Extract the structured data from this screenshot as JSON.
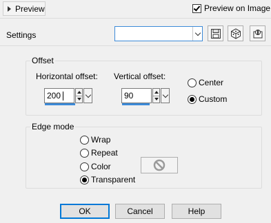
{
  "topbar": {
    "preview_label": "Preview",
    "preview_on_image_label": "Preview on Image",
    "preview_on_image_checked": true
  },
  "settings": {
    "label": "Settings",
    "preset_value": ""
  },
  "offset": {
    "title": "Offset",
    "horizontal_label": "Horizontal offset:",
    "horizontal_value": "200",
    "vertical_label": "Vertical offset:",
    "vertical_value": "90",
    "modes": [
      {
        "label": "Center",
        "selected": false
      },
      {
        "label": "Custom",
        "selected": true
      }
    ]
  },
  "edge_mode": {
    "title": "Edge mode",
    "options": [
      {
        "label": "Wrap",
        "selected": false
      },
      {
        "label": "Repeat",
        "selected": false
      },
      {
        "label": "Color",
        "selected": false
      },
      {
        "label": "Transparent",
        "selected": true
      }
    ],
    "color_swatch_icon": "no-color-icon"
  },
  "buttons": {
    "ok": "OK",
    "cancel": "Cancel",
    "help": "Help"
  },
  "colors": {
    "accent": "#3c8ad8",
    "focus": "#0078d7"
  }
}
